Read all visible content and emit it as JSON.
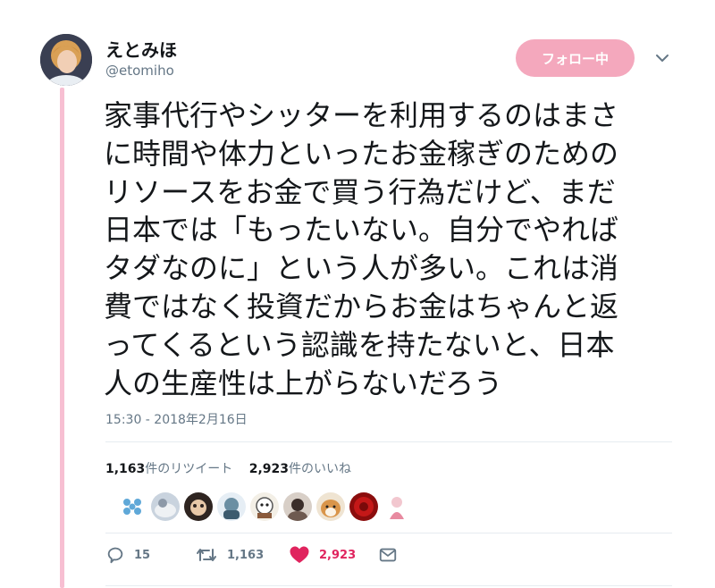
{
  "author": {
    "display_name": "えとみほ",
    "handle": "@etomiho"
  },
  "follow_button": {
    "label": "フォロー中"
  },
  "tweet": {
    "lines": [
      "家事代行やシッターを利用するのはまさ",
      "に時間や体力といったお金稼ぎのための",
      "リソースをお金で買う行為だけど、まだ",
      "日本では「もったいない。自分でやれば",
      "タダなのに」という人が多い。これは消",
      "費ではなく投資だからお金はちゃんと返",
      "ってくるという認識を持たないと、日本",
      "人の生産性は上がらないだろう"
    ],
    "timestamp": "15:30 - 2018年2月16日"
  },
  "stats": {
    "retweets_count": "1,163",
    "retweets_label": "件のリツイート",
    "likes_count": "2,923",
    "likes_label": "件のいいね"
  },
  "actions": {
    "reply_count": "15",
    "retweet_count": "1,163",
    "like_count": "2,923"
  },
  "colors": {
    "follow_bg": "#f4a8bd",
    "thread_line": "#f7bfd2",
    "like_red": "#e0245e",
    "muted": "#657786"
  }
}
